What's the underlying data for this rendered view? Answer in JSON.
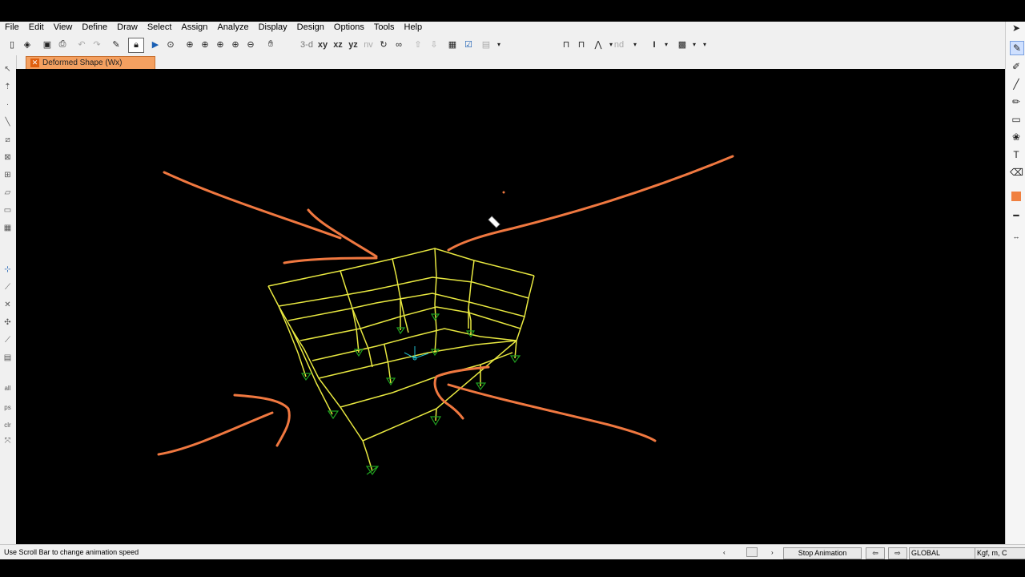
{
  "menu": [
    "File",
    "Edit",
    "View",
    "Define",
    "Draw",
    "Select",
    "Assign",
    "Analyze",
    "Display",
    "Design",
    "Options",
    "Tools",
    "Help"
  ],
  "toolbar": {
    "view_3d": "3-d",
    "view_xy": "xy",
    "view_xz": "xz",
    "view_yz": "yz",
    "view_nv": "nv",
    "nd": "nd"
  },
  "tab": {
    "label": "Deformed Shape (Wx)"
  },
  "status": {
    "message": "Use Scroll Bar to change animation speed",
    "stop_animation": "Stop Animation",
    "coord_system": "GLOBAL",
    "units": "Kgf, m, C"
  },
  "colors": {
    "frame": "#e8e840",
    "annotation": "#f07840",
    "support": "#20a020",
    "axis": "#20c0d0"
  },
  "icons": {
    "pen_tool": "pen-icon",
    "pointer": "pointer-icon"
  }
}
